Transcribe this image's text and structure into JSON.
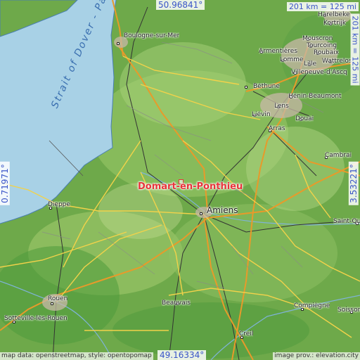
{
  "coords": {
    "top": "50.96841°",
    "bottom": "49.16334°",
    "left": "0.71971°",
    "right": "3.53221°"
  },
  "scale": {
    "horizontal": "201 km = 125 mi",
    "vertical": "201 km = 125 mi"
  },
  "credits": {
    "left": "map data: openstreetmap, style: opentopomap",
    "right": "image prov.: elevation.city"
  },
  "marker": {
    "name": "Domart-en-Ponthieu",
    "color": "#e8343a"
  },
  "sea_label": "Strait of Dover - Pas",
  "cities": [
    {
      "name": "Boulogne-sur-Mer"
    },
    {
      "name": "Harelbeke"
    },
    {
      "name": "Kortrijk"
    },
    {
      "name": "Mouscron"
    },
    {
      "name": "Tourcoing"
    },
    {
      "name": "Roubaix"
    },
    {
      "name": "Wattrelos"
    },
    {
      "name": "Armentières"
    },
    {
      "name": "Lomme"
    },
    {
      "name": "Lille"
    },
    {
      "name": "Villeneuve-d'Ascq"
    },
    {
      "name": "Béthune"
    },
    {
      "name": "Hénin-Beaumont"
    },
    {
      "name": "Lens"
    },
    {
      "name": "Liévin"
    },
    {
      "name": "Douai"
    },
    {
      "name": "Arras"
    },
    {
      "name": "Cambrai"
    },
    {
      "name": "Amiens"
    },
    {
      "name": "Dieppe"
    },
    {
      "name": "Saint-Quentin"
    },
    {
      "name": "Rouen"
    },
    {
      "name": "Sotteville-lès-Rouen"
    },
    {
      "name": "Beauvais"
    },
    {
      "name": "Compiègne"
    },
    {
      "name": "Soissons"
    },
    {
      "name": "Creil"
    }
  ],
  "colors": {
    "sea": "#a8d1e6",
    "land": "#6ea94a",
    "motorway": "#e89a2a",
    "road": "#f2d24a",
    "rail": "#333333",
    "coord_text": "#3a55c8"
  }
}
